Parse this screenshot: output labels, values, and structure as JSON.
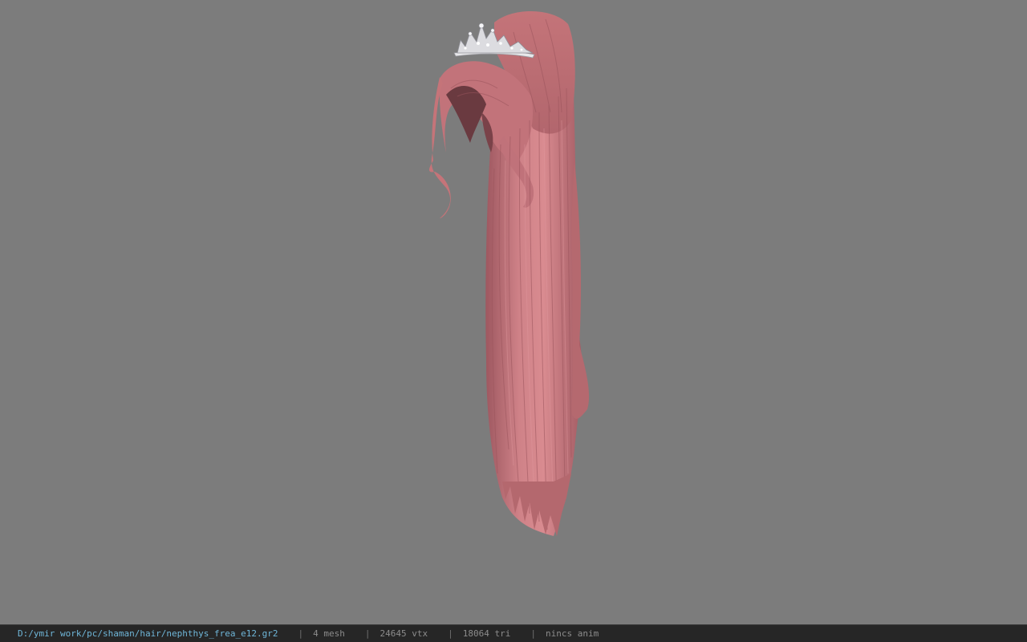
{
  "viewer": {
    "background_color": "#7c7c7c",
    "model": {
      "subject": "hair-model",
      "hair_color": "#c97a80",
      "accessory": "tiara"
    }
  },
  "status_bar": {
    "file_path": "D:/ymir work/pc/shaman/hair/nephthys_frea_e12.gr2",
    "separator": "|",
    "mesh_count": "4 mesh",
    "vertex_count": "24645 vtx",
    "triangle_count": "18064 tri",
    "anim_status": "nincs anim"
  }
}
